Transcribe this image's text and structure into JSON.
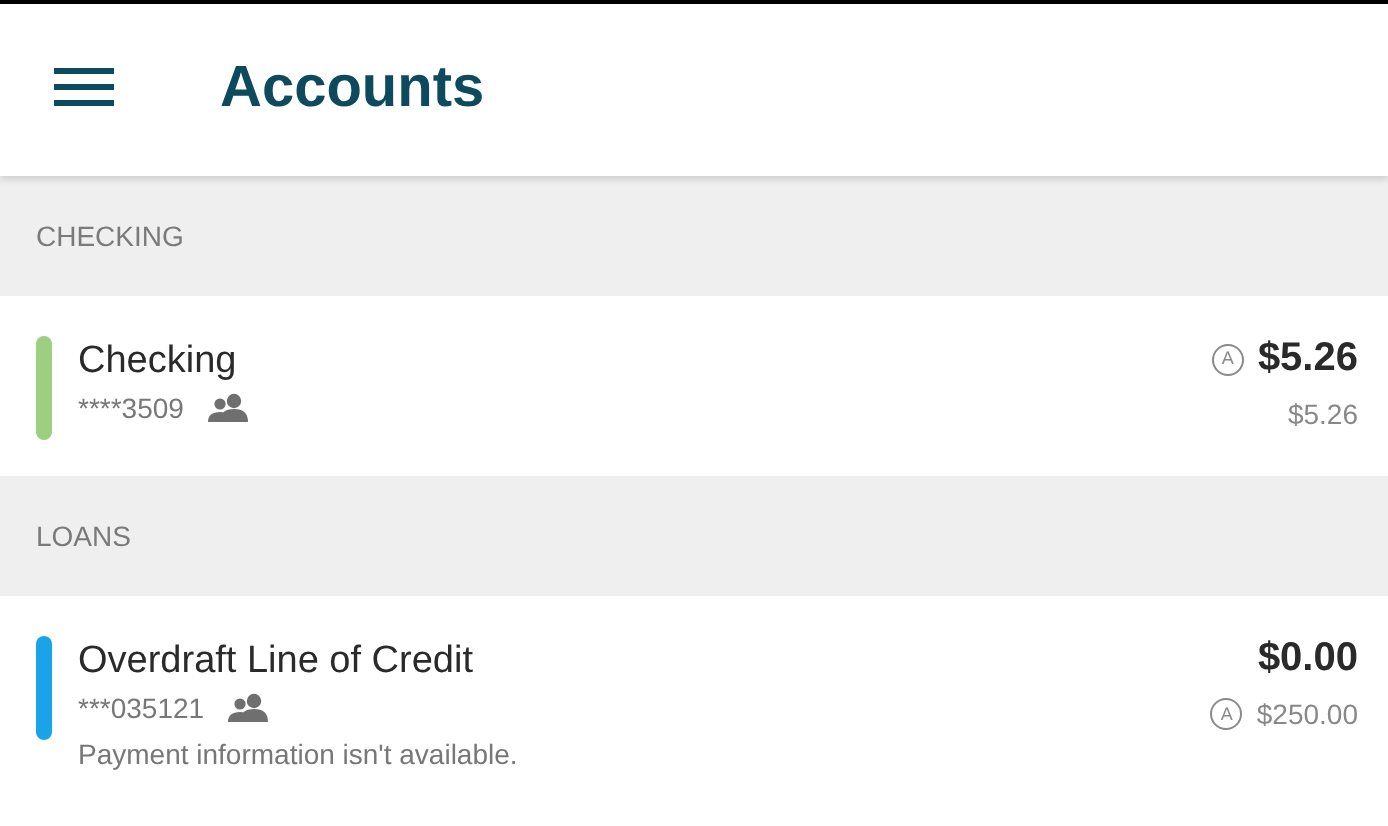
{
  "header": {
    "title": "Accounts"
  },
  "sections": [
    {
      "title": "CHECKING",
      "accounts": [
        {
          "name": "Checking",
          "color": "#9ccf80",
          "number": "****3509",
          "shared": true,
          "balance": {
            "text": "$5.26",
            "badge": "A"
          },
          "secondary": {
            "text": "$5.26"
          }
        }
      ]
    },
    {
      "title": "LOANS",
      "accounts": [
        {
          "name": "Overdraft Line of Credit",
          "color": "#1aa3e8",
          "number": "***035121",
          "shared": true,
          "balance": {
            "text": "$0.00"
          },
          "secondary": {
            "text": "$250.00",
            "badge": "A"
          },
          "note": "Payment information isn't available."
        }
      ]
    }
  ]
}
